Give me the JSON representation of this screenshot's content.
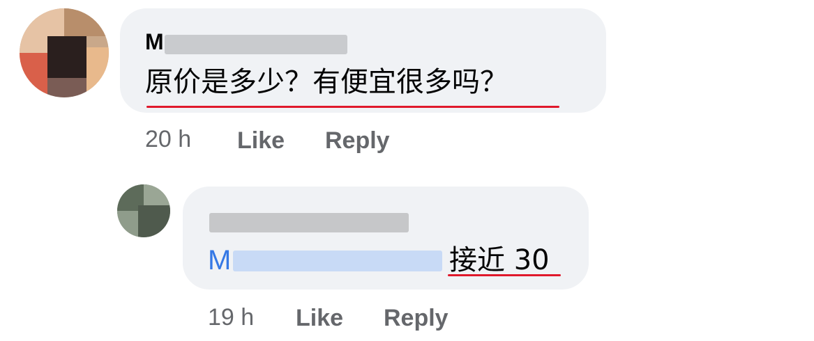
{
  "comments": [
    {
      "author_initial": "M",
      "text": "原价是多少？有便宜很多吗？",
      "time": "20 h",
      "like_label": "Like",
      "reply_label": "Reply"
    },
    {
      "mention_initial": "M",
      "text": "接近 30",
      "time": "19 h",
      "like_label": "Like",
      "reply_label": "Reply"
    }
  ],
  "colors": {
    "bubble": "#f0f2f5",
    "underline": "#e0182b",
    "mention": "#3578e5",
    "meta": "#65676b"
  }
}
